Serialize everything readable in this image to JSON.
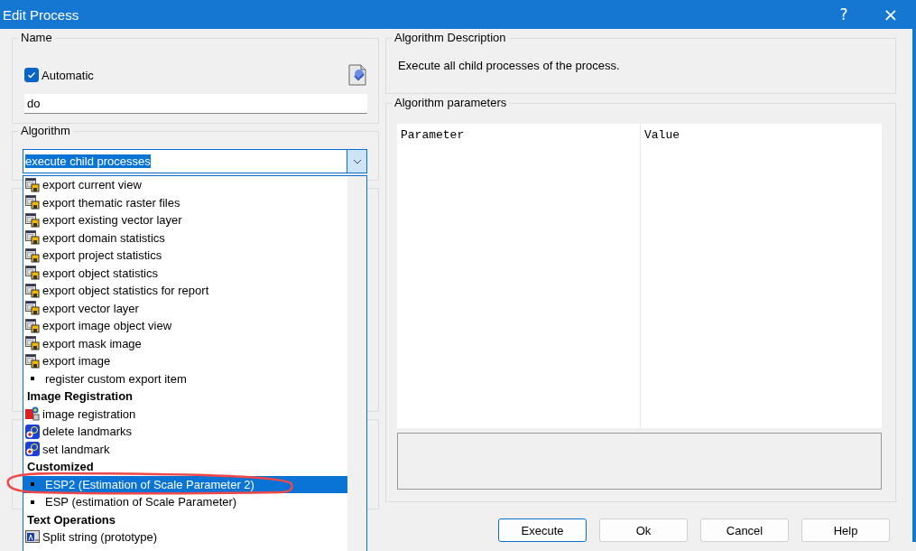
{
  "window": {
    "title": "Edit Process",
    "help": "?",
    "close": "×"
  },
  "name_group": {
    "title": "Name",
    "automatic": {
      "label": "Automatic",
      "checked": true
    },
    "name_value": "do"
  },
  "algorithm_group": {
    "title": "Algorithm",
    "value": "execute child processes",
    "expanded": true
  },
  "algorithm_list": [
    {
      "kind": "export",
      "label": "export current view",
      "selected": false
    },
    {
      "kind": "export",
      "label": "export thematic raster files",
      "selected": false
    },
    {
      "kind": "export",
      "label": "export existing vector layer",
      "selected": false
    },
    {
      "kind": "export",
      "label": "export domain statistics",
      "selected": false
    },
    {
      "kind": "export",
      "label": "export project statistics",
      "selected": false
    },
    {
      "kind": "export",
      "label": "export object statistics",
      "selected": false
    },
    {
      "kind": "export",
      "label": "export object statistics for report",
      "selected": false
    },
    {
      "kind": "export",
      "label": "export vector layer",
      "selected": false
    },
    {
      "kind": "export",
      "label": "export image object view",
      "selected": false
    },
    {
      "kind": "export",
      "label": "export mask image",
      "selected": false
    },
    {
      "kind": "export",
      "label": "export image",
      "selected": false
    },
    {
      "kind": "bullet",
      "label": "register custom export item",
      "selected": false
    },
    {
      "kind": "header",
      "label": "Image Registration"
    },
    {
      "kind": "registration",
      "label": "image registration",
      "selected": false
    },
    {
      "kind": "landmark",
      "label": "delete landmarks",
      "selected": false
    },
    {
      "kind": "landmark",
      "label": "set landmark",
      "selected": false
    },
    {
      "kind": "header",
      "label": "Customized"
    },
    {
      "kind": "bullet",
      "label": "ESP2 (Estimation of Scale Parameter 2)",
      "selected": true
    },
    {
      "kind": "bullet",
      "label": "ESP (estimation of Scale Parameter)",
      "selected": false
    },
    {
      "kind": "header",
      "label": "Text Operations"
    },
    {
      "kind": "text",
      "label": "Split string (prototype)",
      "selected": false
    }
  ],
  "description_group": {
    "title": "Algorithm Description",
    "text": "Execute all child processes of the process."
  },
  "parameters_group": {
    "title": "Algorithm parameters",
    "columns": [
      "Parameter",
      "Value"
    ]
  },
  "buttons": [
    {
      "label": "Execute",
      "default": true
    },
    {
      "label": "Ok",
      "default": false
    },
    {
      "label": "Cancel",
      "default": false
    },
    {
      "label": "Help",
      "default": false
    }
  ]
}
